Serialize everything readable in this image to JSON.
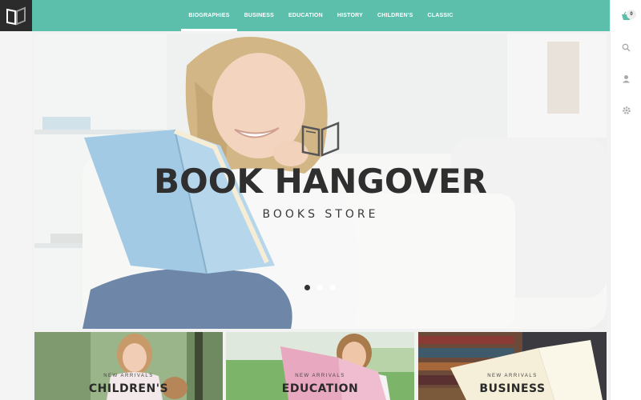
{
  "nav": {
    "items": [
      {
        "label": "BIOGRAPHIES",
        "active": true
      },
      {
        "label": "BUSINESS",
        "active": false
      },
      {
        "label": "EDUCATION",
        "active": false
      },
      {
        "label": "HISTORY",
        "active": false
      },
      {
        "label": "CHILDREN'S",
        "active": false
      },
      {
        "label": "CLASSIC",
        "active": false
      }
    ]
  },
  "rail": {
    "cart_count": "0",
    "icons": [
      "cart-icon",
      "search-icon",
      "user-icon",
      "gear-icon"
    ]
  },
  "hero": {
    "title": "BOOK HANGOVER",
    "subtitle": "BOOKS STORE",
    "slides": 3,
    "active_slide": 1
  },
  "tiles": [
    {
      "tag": "NEW ARRIVALS",
      "name": "CHILDREN'S"
    },
    {
      "tag": "NEW ARRIVALS",
      "name": "EDUCATION"
    },
    {
      "tag": "NEW ARRIVALS",
      "name": "BUSINESS"
    }
  ],
  "colors": {
    "accent": "#5bbfac",
    "logo_bg": "#2b2b2b",
    "title": "#2f2f2f"
  }
}
